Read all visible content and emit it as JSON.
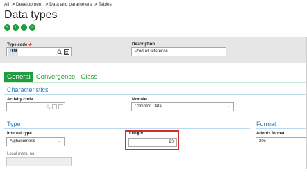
{
  "breadcrumb": {
    "items": [
      "All",
      "Development",
      "Data and parameters",
      "Tables"
    ],
    "separator": ">"
  },
  "page": {
    "title": "Data types"
  },
  "nav_icons": [
    "first-icon",
    "previous-icon",
    "next-icon",
    "last-icon"
  ],
  "header_fields": {
    "type_code": {
      "label": "Type code",
      "required_mark": "★",
      "value": "ITM"
    },
    "description": {
      "label": "Description",
      "value": "Product reference"
    }
  },
  "tabs": [
    {
      "label": "General",
      "active": true
    },
    {
      "label": "Convergence",
      "active": false
    },
    {
      "label": "Class",
      "active": false
    }
  ],
  "sections": {
    "characteristics": "Characteristics",
    "type": "Type",
    "format": "Format"
  },
  "fields": {
    "activity_code": {
      "label": "Activity code",
      "value": ""
    },
    "module": {
      "label": "Module",
      "value": "Common Data"
    },
    "internal_type": {
      "label": "Internal type",
      "value": "Alphanumeric"
    },
    "length": {
      "label": "Length",
      "value": "20"
    },
    "adonix_format": {
      "label": "Adonix format",
      "value": "20c"
    },
    "local_menu_no": {
      "label": "Local menu no.",
      "value": ""
    }
  },
  "colors": {
    "accent_green": "#1f9e3e",
    "section_blue": "#2b7fbf",
    "highlight_red": "#d42b2b",
    "required_red": "#e0342a"
  }
}
